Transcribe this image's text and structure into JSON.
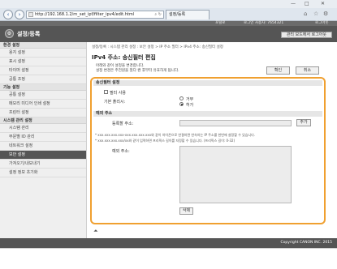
{
  "browser": {
    "url": "http://192.168.1.2/rn_set_ipf/filter_ipv4/edit.html",
    "tab_title": "설정/등록",
    "window_controls": [
      "—",
      "□",
      "✕"
    ],
    "toolbar_icons": [
      "home-icon",
      "star-icon",
      "gear-icon"
    ]
  },
  "header": {
    "app_title": "설정/등록",
    "info_portal": "포털로",
    "info_user": "로그인 사용자: 7654321",
    "info_logout": "로그아웃",
    "logout_button": "관리 모드에서 로그아웃"
  },
  "sidebar": {
    "groups": [
      {
        "heading": "환경 설정",
        "items": [
          "용지 설정",
          "표시 설정",
          "타이머 설정",
          "공통 조정"
        ]
      },
      {
        "heading": "기능 설정",
        "items": [
          "공통 설정",
          "메모리 미디어 인쇄 설정",
          "프린터 설정"
        ]
      },
      {
        "heading": "시스템 관리 설정",
        "items": [
          "시스템 관리",
          "부문별 ID 관리",
          "네트워크 설정",
          "보안 설정",
          "가져오기/내보내기",
          "설정 정보 초기화"
        ]
      }
    ],
    "active": "보안 설정"
  },
  "main": {
    "breadcrumb": "설정/등록 : 시스템 관리 설정 : 보안 설정 > IP 주소 필터 > IPv4 주소: 송신필터 설정",
    "title": "IPv4 주소: 송신필터 편집",
    "desc_line1": "아래와 같이 설정을 변경합니다.",
    "desc_line2": "설정 변경은 주전원을 껐다 켠 후부터 유효하게 됩니다.",
    "ok_button": "확인",
    "cancel_button": "취소",
    "section1": {
      "heading": "송신필터 설정",
      "use_filter_label": "필터 사용",
      "use_filter_checked": false,
      "default_policy_label": "기본 폴리시:",
      "policy_options": [
        "거부",
        "허가"
      ],
      "policy_selected": "허가"
    },
    "section2": {
      "heading": "예외 주소",
      "register_label": "등록할 주소:",
      "register_value": "",
      "add_button": "추가",
      "note1": "* xxx.xxx.xxx.xxx-xxx.xxx.xxx.xxx와 같이 하이픈으로 연결하면 연속하는 IP 주소를 한번에 설정할 수 있습니다.",
      "note2": "* xxx.xxx.xxx.xxx/xx와 같이 입력하면 프리픽스 길이를 지정할 수 있습니다. (프리픽스 길이: 0-32)",
      "exception_label": "예외 주소:",
      "delete_button": "삭제"
    }
  },
  "footer": {
    "copyright": "Copyright CANON INC. 2015"
  },
  "colors": {
    "header_bg": "#555555",
    "active_item_bg": "#555555",
    "panel_highlight": "#f0a030"
  }
}
